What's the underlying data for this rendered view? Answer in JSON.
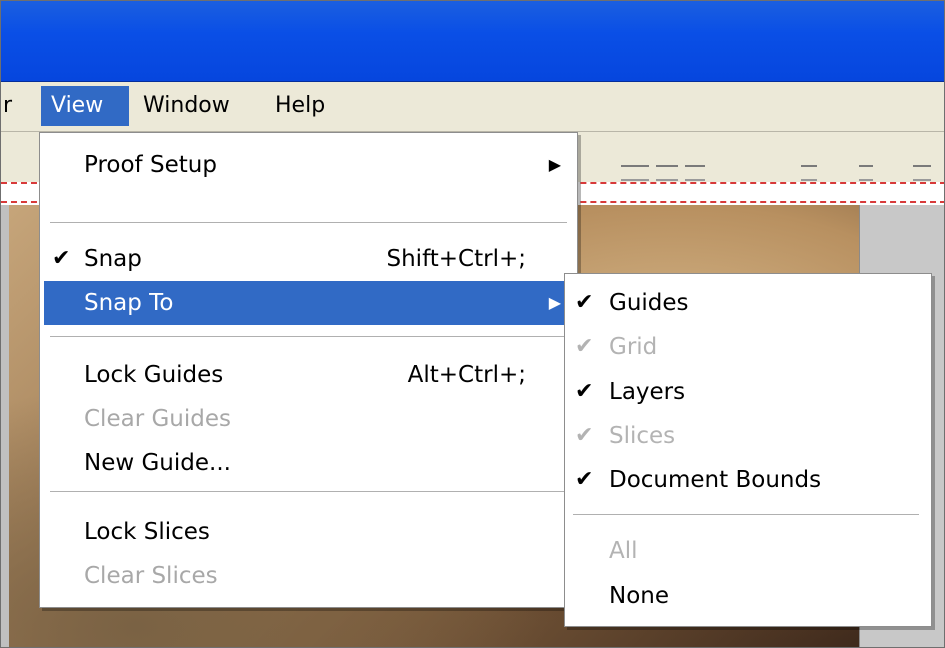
{
  "menubar": {
    "items": [
      {
        "label": "r"
      },
      {
        "label": "View"
      },
      {
        "label": "Window"
      },
      {
        "label": "Help"
      }
    ]
  },
  "view_menu": {
    "items": [
      {
        "label": "Proof Setup",
        "submenu_arrow": "▶"
      },
      {
        "label": "Snap",
        "check": "✔",
        "shortcut": "Shift+Ctrl+;"
      },
      {
        "label": "Snap To",
        "submenu_arrow": "▶"
      },
      {
        "label": "Lock Guides",
        "shortcut": "Alt+Ctrl+;"
      },
      {
        "label": "Clear Guides"
      },
      {
        "label": "New Guide..."
      },
      {
        "label": "Lock Slices"
      },
      {
        "label": "Clear Slices"
      }
    ]
  },
  "snap_to_menu": {
    "items": [
      {
        "label": "Guides",
        "check": "✔"
      },
      {
        "label": "Grid",
        "check": "✔"
      },
      {
        "label": "Layers",
        "check": "✔"
      },
      {
        "label": "Slices",
        "check": "✔"
      },
      {
        "label": "Document Bounds",
        "check": "✔"
      },
      {
        "label": "All"
      },
      {
        "label": "None"
      }
    ]
  },
  "colors": {
    "selection": "#316ac5",
    "titlebar": "#0a4fe6",
    "menubar": "#ece9d8",
    "disabled_text": "#a8a8a8"
  }
}
